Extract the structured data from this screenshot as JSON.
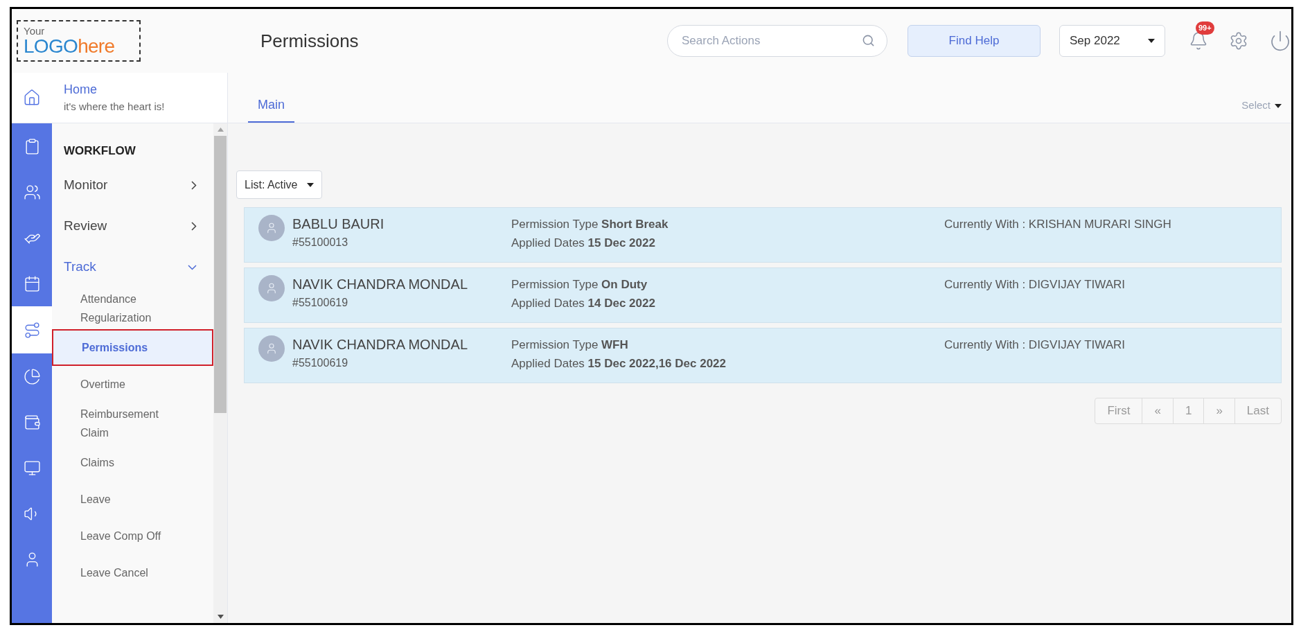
{
  "logo": {
    "top": "Your",
    "main": "LOGO",
    "accent": "here"
  },
  "header": {
    "title": "Permissions",
    "search": {
      "placeholder": "Search Actions"
    },
    "help_button": "Find Help",
    "period": "Sep 2022",
    "notification_badge": "99+"
  },
  "home": {
    "title": "Home",
    "subtitle": "it's where the heart is!"
  },
  "rail": [
    {
      "kind": "clipboard",
      "selected": false
    },
    {
      "kind": "users",
      "selected": false
    },
    {
      "kind": "hand",
      "selected": false
    },
    {
      "kind": "calendar",
      "selected": false
    },
    {
      "kind": "route",
      "selected": true
    },
    {
      "kind": "pie",
      "selected": false
    },
    {
      "kind": "wallet",
      "selected": false
    },
    {
      "kind": "monitor",
      "selected": false
    },
    {
      "kind": "speaker",
      "selected": false
    },
    {
      "kind": "user",
      "selected": false
    }
  ],
  "menu": {
    "section": "WORKFLOW",
    "items": [
      {
        "label": "Monitor",
        "expanded": false
      },
      {
        "label": "Review",
        "expanded": false
      },
      {
        "label": "Track",
        "expanded": true,
        "children": [
          {
            "label": "Attendance Regularization",
            "selected": false
          },
          {
            "label": "Permissions",
            "selected": true
          },
          {
            "label": "Overtime",
            "selected": false
          },
          {
            "label": "Reimbursement Claim",
            "selected": false
          },
          {
            "label": "Claims",
            "selected": false
          },
          {
            "label": "Leave",
            "selected": false
          },
          {
            "label": "Leave Comp Off",
            "selected": false
          },
          {
            "label": "Leave Cancel",
            "selected": false
          }
        ]
      }
    ]
  },
  "tabs": [
    {
      "label": "Main",
      "selected": true
    }
  ],
  "select_menu": "Select",
  "list_filter": "List: Active",
  "records": [
    {
      "name": "BABLU BAURI",
      "id": "#55100013",
      "type": "Permission Type **Short Break**",
      "dates": "Applied Dates **15 Dec 2022**",
      "currently_with": "Currently With : KRISHAN MURARI SINGH"
    },
    {
      "name": "NAVIK CHANDRA MONDAL",
      "id": "#55100619",
      "type": "Permission Type **On Duty**",
      "dates": "Applied Dates **14 Dec 2022**",
      "currently_with": "Currently With : DIGVIJAY TIWARI"
    },
    {
      "name": "NAVIK CHANDRA MONDAL",
      "id": "#55100619",
      "type": "Permission Type **WFH**",
      "dates": "Applied Dates **15 Dec 2022,16 Dec 2022**",
      "currently_with": "Currently With : DIGVIJAY TIWARI"
    }
  ],
  "pagination": [
    "First",
    "«",
    "1",
    "»",
    "Last"
  ]
}
